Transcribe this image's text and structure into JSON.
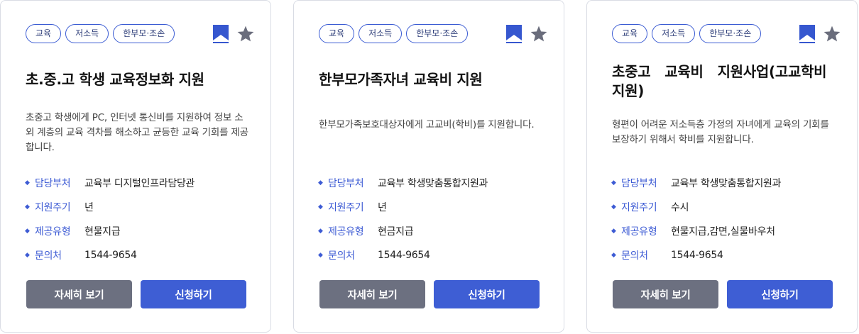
{
  "colors": {
    "accent": "#3e5ed4",
    "detail_button": "#6c7080",
    "bookmark": "#3657cf",
    "star": "#6a6d7c"
  },
  "icons": {
    "bookmark": "bookmark-icon",
    "favorite": "star-icon",
    "bullet": "diamond-bullet-icon"
  },
  "labels": {
    "department": "담당부처",
    "cycle": "지원주기",
    "provision_type": "제공유형",
    "contact": "문의처",
    "detail_button": "자세히 보기",
    "apply_button": "신청하기"
  },
  "cards": [
    {
      "tags": [
        "교육",
        "저소득",
        "한부모·조손"
      ],
      "title": "초.중.고 학생 교육정보화 지원",
      "description": "초중고 학생에게 PC, 인터넷 통신비를 지원하여 정보 소외 계층의 교육 격차를 해소하고 균등한 교육 기회를 제공합니다.",
      "department": "교육부 디지털인프라담당관",
      "cycle": "년",
      "provision_type": "현물지급",
      "contact": "1544-9654"
    },
    {
      "tags": [
        "교육",
        "저소득",
        "한부모·조손"
      ],
      "title": "한부모가족자녀 교육비 지원",
      "description": "한부모가족보호대상자에게  고교비(학비)를  지원합니다.",
      "department": "교육부 학생맞춤통합지원과",
      "cycle": "년",
      "provision_type": "현금지급",
      "contact": "1544-9654"
    },
    {
      "tags": [
        "교육",
        "저소득",
        "한부모·조손"
      ],
      "title": "초중고   교육비   지원사업(고교학비지원)",
      "description": "형편이 어려운 저소득층 가정의 자녀에게 교육의 기회를 보장하기 위해서 학비를 지원합니다.",
      "department": "교육부 학생맞춤통합지원과",
      "cycle": "수시",
      "provision_type": "현물지급,감면,실물바우처",
      "contact": "1544-9654"
    }
  ]
}
